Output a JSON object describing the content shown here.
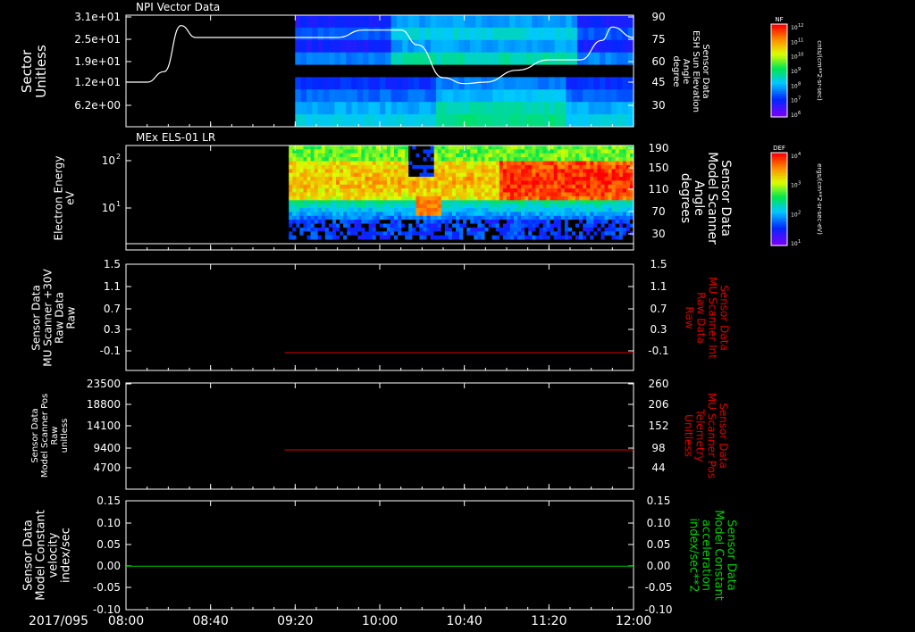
{
  "date_label": "2017/095",
  "time_ticks": [
    "08:00",
    "08:40",
    "09:20",
    "10:00",
    "10:40",
    "11:20",
    "12:00"
  ],
  "colors": {
    "white": "#ffffff",
    "red": "#e00000",
    "green": "#00d000",
    "axis": "#ffffff"
  },
  "chart_data": [
    {
      "panel": 1,
      "type": "heatmap",
      "title": "NPI Vector Data",
      "ylabel": [
        "Sector",
        "Unitless"
      ],
      "yticks": [
        "3.1e+01",
        "2.5e+01",
        "1.9e+01",
        "1.2e+01",
        "6.2e+00"
      ],
      "y2label": [
        "Sensor Data",
        "ESH Sun Elevation",
        "Angle",
        "degree"
      ],
      "y2ticks": [
        "90",
        "75",
        "60",
        "45",
        "30"
      ],
      "y2lim": [
        15,
        90
      ],
      "colorbar": {
        "title": "NF",
        "label": "cnts/(cm**2-sr-sec)",
        "ticks": [
          "10^12",
          "10^11",
          "10^10",
          "10^9",
          "10^8",
          "10^7",
          "10^6"
        ]
      },
      "data_start_time": "09:20",
      "line_series": {
        "name": "ESH Sun Elevation",
        "points": [
          [
            "08:00",
            45
          ],
          [
            "08:10",
            45
          ],
          [
            "08:18",
            52
          ],
          [
            "08:26",
            83
          ],
          [
            "08:33",
            75
          ],
          [
            "08:40",
            75
          ],
          [
            "09:20",
            75
          ],
          [
            "09:40",
            75
          ],
          [
            "09:52",
            80
          ],
          [
            "10:10",
            80
          ],
          [
            "10:18",
            70
          ],
          [
            "10:30",
            48
          ],
          [
            "10:40",
            44
          ],
          [
            "10:50",
            45
          ],
          [
            "11:05",
            53
          ],
          [
            "11:20",
            60
          ],
          [
            "11:35",
            60
          ],
          [
            "11:45",
            73
          ],
          [
            "11:50",
            82
          ],
          [
            "12:00",
            75
          ]
        ]
      }
    },
    {
      "panel": 2,
      "type": "heatmap",
      "title": "MEx ELS-01 LR",
      "ylabel": [
        "Electron Energy",
        "eV"
      ],
      "yticks": [
        "10^2",
        "10^1"
      ],
      "y2label": [
        "Sensor Data",
        "Model Scanner",
        "Angle",
        "degrees"
      ],
      "y2ticks": [
        "190",
        "150",
        "110",
        "70",
        "30"
      ],
      "colorbar": {
        "title": "DEF",
        "label": "ergs/(cm**2-sr-sec-eV)",
        "ticks": [
          "10^4",
          "10^3",
          "10^2",
          "10^1"
        ]
      },
      "data_start_time": "09:17"
    },
    {
      "panel": 3,
      "type": "line",
      "ylabel": [
        "Sensor Data",
        "MU Scanner +30V",
        "Raw Data",
        "Raw"
      ],
      "yticks": [
        "1.5",
        "1.1",
        "0.7",
        "0.3",
        "-0.1"
      ],
      "ylim": [
        -0.3,
        1.5
      ],
      "y2label": [
        "Sensor Data",
        "MU Scanner Int",
        "Raw Data",
        "Raw"
      ],
      "y2ticks": [
        "1.5",
        "1.1",
        "0.7",
        "0.3",
        "-0.1"
      ],
      "series": [
        {
          "start": "09:15",
          "end": "12:00",
          "value": 0.0
        }
      ]
    },
    {
      "panel": 4,
      "type": "line",
      "ylabel": [
        "Sensor Data",
        "Model Scanner Pos",
        "Raw",
        "unitless"
      ],
      "yticks": [
        "23500",
        "18800",
        "14100",
        "9400",
        "4700"
      ],
      "ylim": [
        0,
        23500
      ],
      "y2label": [
        "Sensor Data",
        "MU Scanner Pos",
        "Telemetry",
        "Unitless"
      ],
      "y2ticks": [
        "260",
        "206",
        "152",
        "98",
        "44"
      ],
      "series": [
        {
          "start": "09:15",
          "end": "12:00",
          "value": 8700
        }
      ]
    },
    {
      "panel": 5,
      "type": "line",
      "ylabel": [
        "Sensor Data",
        "Model Constant",
        "velocity",
        "index/sec"
      ],
      "yticks": [
        "0.15",
        "0.10",
        "0.05",
        "0.00",
        "-0.05",
        "-0.10"
      ],
      "ylim": [
        -0.1,
        0.15
      ],
      "y2label": [
        "Sensor Data",
        "Model Constant",
        "acceleration",
        "index/sec**2"
      ],
      "y2ticks": [
        "0.15",
        "0.10",
        "0.05",
        "0.00",
        "-0.05",
        "-0.10"
      ],
      "series": [
        {
          "start": "08:00",
          "end": "12:00",
          "value": 0.0
        }
      ]
    }
  ]
}
